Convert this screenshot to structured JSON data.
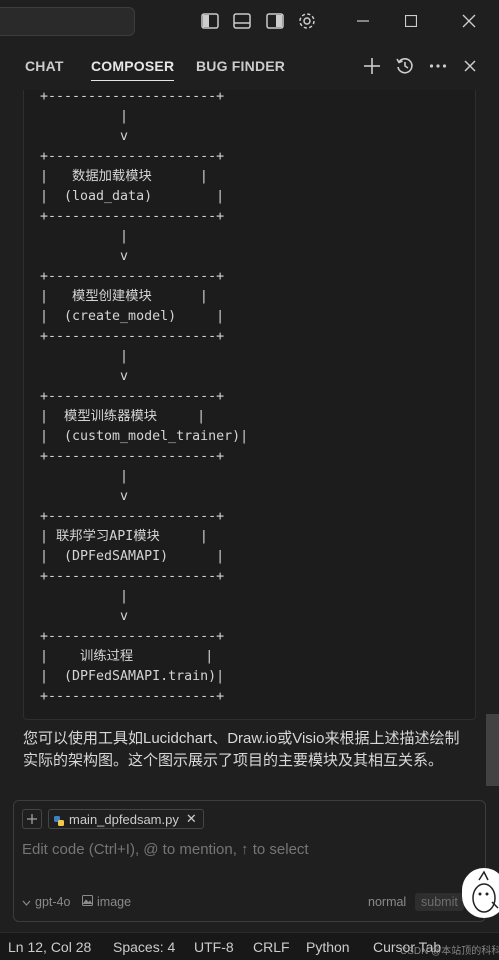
{
  "titlebar": {
    "icons": [
      "toggle-primary-sidebar-icon",
      "toggle-panel-icon",
      "toggle-secondary-sidebar-icon",
      "gear-icon"
    ],
    "window_controls": [
      "minimize-icon",
      "maximize-icon",
      "close-icon"
    ]
  },
  "tabs": [
    {
      "label": "CHAT",
      "active": false
    },
    {
      "label": "COMPOSER",
      "active": true
    },
    {
      "label": "BUG FINDER",
      "active": false
    }
  ],
  "tab_actions": [
    "plus-icon",
    "history-icon",
    "more-icon",
    "close-icon"
  ],
  "code_block": {
    "text": "+---------------------+\n          |\n          v\n+---------------------+\n|   数据加载模块      |\n|  (load_data)        |\n+---------------------+\n          |\n          v\n+---------------------+\n|   模型创建模块      |\n|  (create_model)     |\n+---------------------+\n          |\n          v\n+---------------------+\n|  模型训练器模块     |\n|  (custom_model_trainer)|\n+---------------------+\n          |\n          v\n+---------------------+\n| 联邦学习API模块     |\n|  (DPFedSAMAPI)      |\n+---------------------+\n          |\n          v\n+---------------------+\n|    训练过程         |\n|  (DPFedSAMAPI.train)|\n+---------------------+"
  },
  "message": {
    "text": "您可以使用工具如Lucidchart、Draw.io或Visio来根据上述描述绘制实际的架构图。这个图示展示了项目的主要模块及其相互关系。"
  },
  "composer": {
    "file_chip": "main_dpfedsam.py",
    "placeholder": "Edit code (Ctrl+I), @ to mention, ↑ to select",
    "model": "gpt-4o",
    "image_label": "image",
    "mode": "normal",
    "submit_label": "submit"
  },
  "statusbar": {
    "position": "Ln 12, Col 28",
    "spaces": "Spaces: 4",
    "encoding": "UTF-8",
    "eol": "CRLF",
    "language": "Python",
    "cursor_tab": "Cursor Tab",
    "watermark": "CSDN @本站顶的科科生"
  },
  "colors": {
    "background": "#1f1f1f",
    "text": "#cccccc",
    "python_icon_blue": "#3d7fc1",
    "python_icon_yellow": "#f2c94c"
  }
}
